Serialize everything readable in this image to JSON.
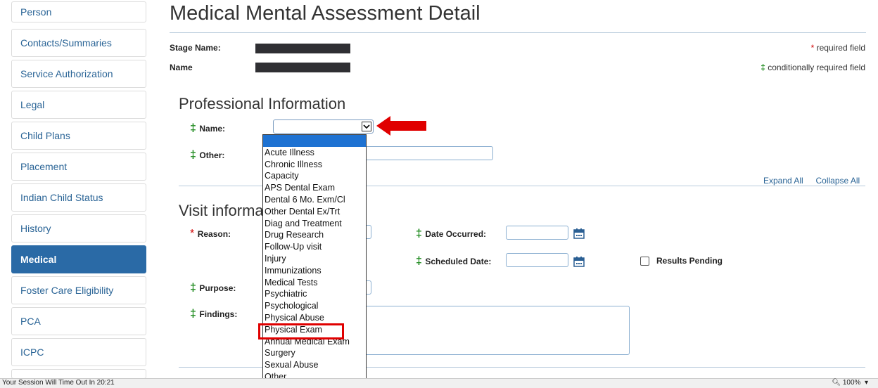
{
  "sidebar": {
    "items": [
      {
        "label": "Person",
        "active": false
      },
      {
        "label": "Contacts/Summaries",
        "active": false
      },
      {
        "label": "Service Authorization",
        "active": false
      },
      {
        "label": "Legal",
        "active": false
      },
      {
        "label": "Child Plans",
        "active": false
      },
      {
        "label": "Placement",
        "active": false
      },
      {
        "label": "Indian Child Status",
        "active": false
      },
      {
        "label": "History",
        "active": false
      },
      {
        "label": "Medical",
        "active": true
      },
      {
        "label": "Foster Care Eligibility",
        "active": false
      },
      {
        "label": "PCA",
        "active": false
      },
      {
        "label": "ICPC",
        "active": false
      }
    ]
  },
  "header": {
    "title": "Medical Mental Assessment Detail",
    "stage_name_label": "Stage Name:",
    "name_label": "Name",
    "required_legend_symbol": "*",
    "required_legend": "required field",
    "conditional_legend_symbol": "‡",
    "conditional_legend": "conditionally required field"
  },
  "professional": {
    "heading": "Professional Information",
    "name_label": "Name:",
    "name_value": "",
    "other_label": "Other:",
    "other_value": "",
    "expand_all": "Expand All",
    "collapse_all": "Collapse All"
  },
  "visit": {
    "heading": "Visit information",
    "reason_label": "Reason:",
    "date_occurred_label": "Date Occurred:",
    "date_occurred_value": "",
    "scheduled_date_label": "Scheduled Date:",
    "scheduled_date_value": "",
    "results_pending_label": "Results Pending",
    "results_pending_checked": false,
    "purpose_label": "Purpose:",
    "findings_label": "Findings:",
    "findings_value": ""
  },
  "dropdown": {
    "options": [
      "",
      "Acute Illness",
      "Chronic Illness",
      "Capacity",
      "APS Dental Exam",
      "Dental 6 Mo. Exm/Cl",
      "Other Dental Ex/Trt",
      "Diag and Treatment",
      "Drug Research",
      "Follow-Up visit",
      "Injury",
      "Immunizations",
      "Medical Tests",
      "Psychiatric",
      "Psychological",
      "Physical Abuse",
      "Physical Exam",
      "Annual Medical Exam",
      "Surgery",
      "Sexual Abuse",
      "Other"
    ],
    "highlighted_index": 0,
    "annotated_option": "Physical Exam"
  },
  "status_bar": {
    "session_text": "Your Session Will Time Out In 20:21",
    "zoom": "100%"
  },
  "colors": {
    "accent": "#2a6aa6",
    "required": "#d00000",
    "conditional": "#1d8a1d",
    "annotation": "#e00000"
  }
}
